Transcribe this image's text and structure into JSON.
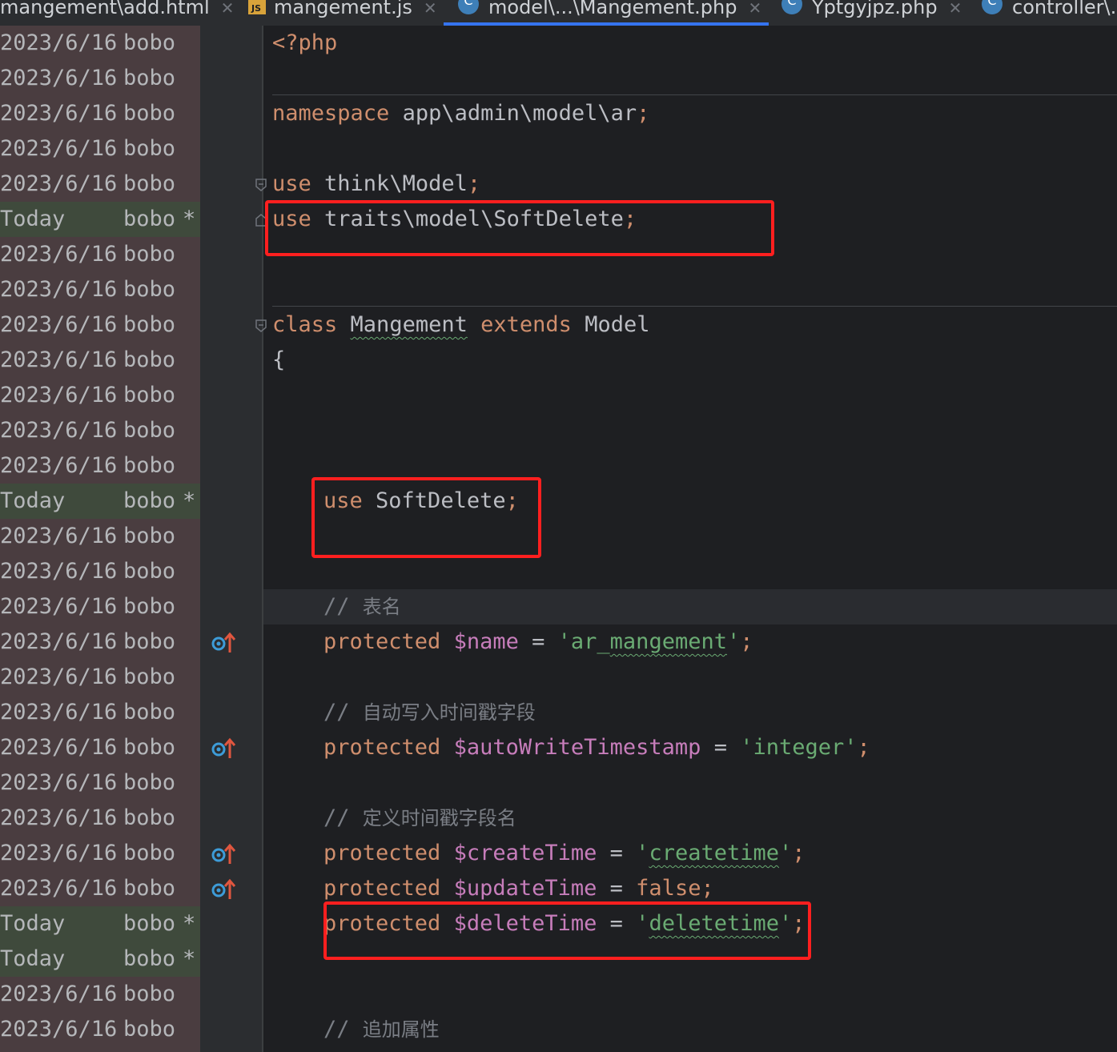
{
  "tabs": [
    {
      "label": "mangement\\add.html",
      "icon": "html-file-icon"
    },
    {
      "label": "mangement.js",
      "icon": "js-file-icon"
    },
    {
      "label": "model\\...\\Mangement.php",
      "icon": "php-class-icon",
      "active": true
    },
    {
      "label": "Yptgyjpz.php",
      "icon": "php-class-icon"
    },
    {
      "label": "controller\\...",
      "icon": "php-class-icon"
    }
  ],
  "blame": [
    {
      "date": "2023/6/16",
      "author": "bobo",
      "star": ""
    },
    {
      "date": "2023/6/16",
      "author": "bobo",
      "star": ""
    },
    {
      "date": "2023/6/16",
      "author": "bobo",
      "star": ""
    },
    {
      "date": "2023/6/16",
      "author": "bobo",
      "star": ""
    },
    {
      "date": "2023/6/16",
      "author": "bobo",
      "star": ""
    },
    {
      "date": "Today",
      "author": "bobo",
      "star": "*"
    },
    {
      "date": "2023/6/16",
      "author": "bobo",
      "star": ""
    },
    {
      "date": "2023/6/16",
      "author": "bobo",
      "star": ""
    },
    {
      "date": "2023/6/16",
      "author": "bobo",
      "star": ""
    },
    {
      "date": "2023/6/16",
      "author": "bobo",
      "star": ""
    },
    {
      "date": "2023/6/16",
      "author": "bobo",
      "star": ""
    },
    {
      "date": "2023/6/16",
      "author": "bobo",
      "star": ""
    },
    {
      "date": "2023/6/16",
      "author": "bobo",
      "star": ""
    },
    {
      "date": "Today",
      "author": "bobo",
      "star": "*"
    },
    {
      "date": "2023/6/16",
      "author": "bobo",
      "star": ""
    },
    {
      "date": "2023/6/16",
      "author": "bobo",
      "star": ""
    },
    {
      "date": "2023/6/16",
      "author": "bobo",
      "star": ""
    },
    {
      "date": "2023/6/16",
      "author": "bobo",
      "star": ""
    },
    {
      "date": "2023/6/16",
      "author": "bobo",
      "star": ""
    },
    {
      "date": "2023/6/16",
      "author": "bobo",
      "star": ""
    },
    {
      "date": "2023/6/16",
      "author": "bobo",
      "star": ""
    },
    {
      "date": "2023/6/16",
      "author": "bobo",
      "star": ""
    },
    {
      "date": "2023/6/16",
      "author": "bobo",
      "star": ""
    },
    {
      "date": "2023/6/16",
      "author": "bobo",
      "star": ""
    },
    {
      "date": "2023/6/16",
      "author": "bobo",
      "star": ""
    },
    {
      "date": "Today",
      "author": "bobo",
      "star": "*"
    },
    {
      "date": "Today",
      "author": "bobo",
      "star": "*"
    },
    {
      "date": "2023/6/16",
      "author": "bobo",
      "star": ""
    },
    {
      "date": "2023/6/16",
      "author": "bobo",
      "star": ""
    }
  ],
  "code": {
    "php_open": "<?php",
    "ns_kw": "namespace",
    "ns_name": " app\\admin\\model\\ar",
    "ns_semi": ";",
    "use1_kw": "use",
    "use1_name": " think\\Model",
    "use1_semi": ";",
    "use2_kw": "use",
    "use2_name": " traits\\model\\SoftDelete",
    "use2_semi": ";",
    "class_kw": "class",
    "class_name": "Mangement",
    "extends_kw": "extends",
    "parent": "Model",
    "brace": "{",
    "use3_kw": "use",
    "use3_name": " SoftDelete",
    "use3_semi": ";",
    "c1_slash": "// ",
    "c1_text": "表名",
    "p1_kw": "protected",
    "p1_var": "$name",
    "p1_eq": " = ",
    "p1_q1": "'ar_",
    "p1_val": "mangement",
    "p1_q2": "'",
    "p1_semi": ";",
    "c2_slash": "// ",
    "c2_text": "自动写入时间戳字段",
    "p2_kw": "protected",
    "p2_var": "$autoWriteTimestamp",
    "p2_eq": " = ",
    "p2_val": "'integer'",
    "p2_semi": ";",
    "c3_slash": "// ",
    "c3_text": "定义时间戳字段名",
    "p3_kw": "protected",
    "p3_var": "$createTime",
    "p3_eq": " = ",
    "p3_q1": "'",
    "p3_val": "createtime",
    "p3_q2": "'",
    "p3_semi": ";",
    "p4_kw": "protected",
    "p4_var": "$updateTime",
    "p4_eq": " = ",
    "p4_val": "false",
    "p4_semi": ";",
    "p5_kw": "protected",
    "p5_var": "$deleteTime",
    "p5_eq": " = ",
    "p5_q1": "'",
    "p5_val": "deletetime",
    "p5_q2": "'",
    "p5_semi": ";",
    "c4_slash": "// ",
    "c4_text": "追加属性"
  },
  "colors": {
    "highlight_box": "#ff1f1f",
    "keyword": "#cf8e6d",
    "variable": "#c77dbb",
    "string": "#6aab73"
  }
}
